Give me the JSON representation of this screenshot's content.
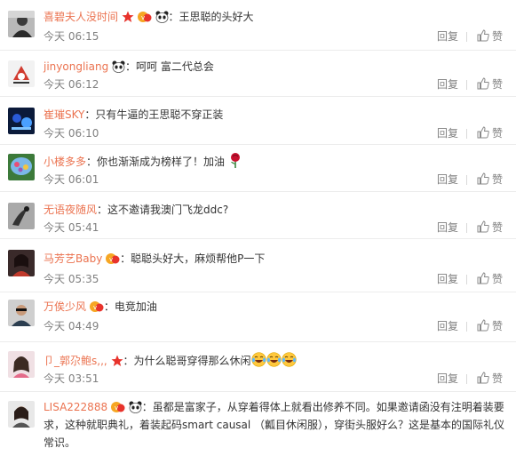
{
  "reply_label": "回复",
  "like_label": "赞",
  "colors": {
    "username": "#eb7350",
    "meta": "#808080",
    "divider": "#ececec"
  },
  "comments": [
    {
      "user": "喜碧夫人没时间",
      "badges": [
        "red-star-icon",
        "vip-badge-icon",
        "panda-icon"
      ],
      "text": "王思聪的头好大",
      "time": "今天 06:15"
    },
    {
      "user": "jinyongliang",
      "badges": [
        "panda-icon"
      ],
      "text": "呵呵 富二代总会",
      "time": "今天 06:12"
    },
    {
      "user": "崔璀SKY",
      "badges": [],
      "text": "只有牛逼的王思聪不穿正装",
      "time": "今天 06:10"
    },
    {
      "user": "小楼多多",
      "badges": [],
      "text": "你也渐渐成为榜样了！加油",
      "emoji_after": [
        "rose-icon"
      ],
      "time": "今天 06:01"
    },
    {
      "user": "无语夜随风",
      "badges": [],
      "text": "这不邀请我澳门飞龙ddc?",
      "time": "今天 05:41"
    },
    {
      "user": "马芳艺Baby",
      "badges": [
        "vip-badge-icon"
      ],
      "text": "聪聪头好大，麻烦帮他P一下",
      "time": "今天 05:35"
    },
    {
      "user": "万俟少风",
      "badges": [
        "vip-badge-icon"
      ],
      "text": "电竞加油",
      "time": "今天 04:49"
    },
    {
      "user": "卩_郭尕鲍s,,,",
      "badges": [
        "red-star-icon"
      ],
      "text": "为什么聪哥穿得那么休闲",
      "emoji_after": [
        "laugh-cry-icon",
        "laugh-cry-icon",
        "laugh-cry-icon"
      ],
      "time": "今天 03:51"
    },
    {
      "user": "LISA222888",
      "badges": [
        "vip-badge-icon",
        "panda-icon"
      ],
      "text": "虽都是富家子，从穿着得体上就看出修养不同。如果邀请函没有注明着装要求，这种就职典礼，着装起码smart causal （瓤目休闲服），穿街头服好么？这是基本的国际礼仪常识。",
      "time": ""
    }
  ]
}
